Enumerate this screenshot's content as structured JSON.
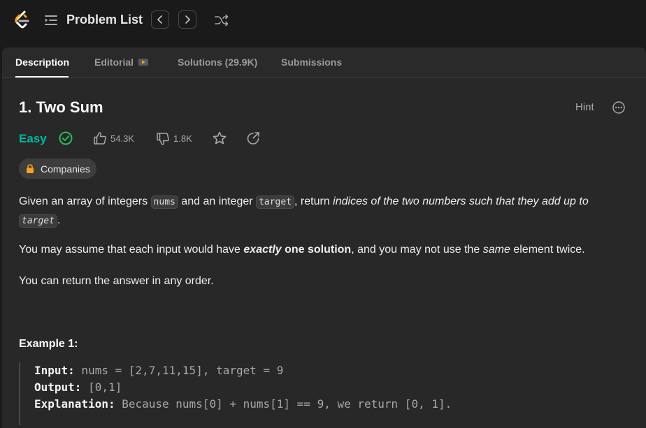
{
  "header": {
    "title": "Problem List"
  },
  "tabs": [
    {
      "label": "Description"
    },
    {
      "label": "Editorial"
    },
    {
      "label": "Solutions (29.9K)"
    },
    {
      "label": "Submissions"
    }
  ],
  "problem": {
    "title": "1. Two Sum",
    "hint_label": "Hint",
    "difficulty": "Easy",
    "likes": "54.3K",
    "dislikes": "1.8K",
    "companies_label": "Companies"
  },
  "description": {
    "p1": {
      "t1": "Given an array of integers ",
      "code1": "nums",
      "t2": " and an integer ",
      "code2": "target",
      "t3": ", return ",
      "em1": "indices of the two numbers such that they add up to ",
      "code3": "target",
      "t4": "."
    },
    "p2": {
      "t1": "You may assume that each input would have ",
      "strong": "exactly",
      "strong2": " one solution",
      "t2": ", and you may not use the ",
      "em": "same",
      "t3": " element twice."
    },
    "p3": "You can return the answer in any order."
  },
  "example1": {
    "title": "Example 1:",
    "input_label": "Input:",
    "input_value": " nums = [2,7,11,15], target = 9",
    "output_label": "Output:",
    "output_value": " [0,1]",
    "explanation_label": "Explanation:",
    "explanation_value": " Because nums[0] + nums[1] == 9, we return [0, 1]."
  },
  "colors": {
    "easy": "#00b8a3",
    "solved": "#2cbb5d",
    "background": "#282828"
  },
  "icons": [
    "leetcode-logo-icon",
    "list-icon",
    "chevron-left-icon",
    "chevron-right-icon",
    "shuffle-icon",
    "video-icon",
    "more-icon",
    "check-circle-icon",
    "thumbs-up-icon",
    "thumbs-down-icon",
    "star-icon",
    "share-icon",
    "lock-icon"
  ]
}
